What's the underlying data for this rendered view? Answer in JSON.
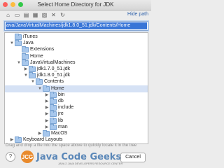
{
  "window": {
    "title": "Select Home Directory for JDK"
  },
  "toolbar": {
    "buttons": [
      "home-icon",
      "desktop-icon",
      "project-icon",
      "module-icon",
      "new-folder-icon",
      "delete-icon",
      "refresh-icon"
    ],
    "hide_path_label": "Hide path"
  },
  "path": {
    "value": "ava/JavaVirtualMachines/jdk1.8.0_51.jdk/Contents/Home"
  },
  "tree": {
    "items": [
      {
        "label": "iTunes",
        "indent": 1,
        "arrow": "",
        "selected": false
      },
      {
        "label": "Java",
        "indent": 1,
        "arrow": "▼",
        "selected": false
      },
      {
        "label": "Extensions",
        "indent": 2,
        "arrow": "",
        "selected": false
      },
      {
        "label": "Home",
        "indent": 2,
        "arrow": "",
        "selected": false
      },
      {
        "label": "JavaVirtualMachines",
        "indent": 2,
        "arrow": "▼",
        "selected": false
      },
      {
        "label": "jdk1.7.0_51.jdk",
        "indent": 3,
        "arrow": "▶",
        "selected": false
      },
      {
        "label": "jdk1.8.0_51.jdk",
        "indent": 3,
        "arrow": "▼",
        "selected": false
      },
      {
        "label": "Contents",
        "indent": 4,
        "arrow": "▼",
        "selected": false
      },
      {
        "label": "Home",
        "indent": 5,
        "arrow": "▼",
        "selected": true
      },
      {
        "label": "bin",
        "indent": 6,
        "arrow": "▶",
        "selected": false
      },
      {
        "label": "db",
        "indent": 6,
        "arrow": "▶",
        "selected": false
      },
      {
        "label": "include",
        "indent": 6,
        "arrow": "▶",
        "selected": false
      },
      {
        "label": "jre",
        "indent": 6,
        "arrow": "▶",
        "selected": false
      },
      {
        "label": "lib",
        "indent": 6,
        "arrow": "▶",
        "selected": false
      },
      {
        "label": "man",
        "indent": 6,
        "arrow": "▶",
        "selected": false
      },
      {
        "label": "MacOS",
        "indent": 5,
        "arrow": "▶",
        "selected": false
      },
      {
        "label": "Keyboard Layouts",
        "indent": 1,
        "arrow": "▶",
        "selected": false
      }
    ]
  },
  "hint": "Drag and drop a file into the space above to quickly locate it in the tree",
  "watermark": {
    "logo_text": "JCG",
    "text": "Java Code Geeks",
    "subtitle": "JAVA 2 JAVA DEVELOPERS RESOURCE CENTER"
  },
  "buttons": {
    "help": "?",
    "cancel": "Cancel"
  },
  "colors": {
    "selection": "#3875d7",
    "tree_selection": "#d6e2f5",
    "folder": "#a7c7ec",
    "link": "#2b5ea8"
  }
}
